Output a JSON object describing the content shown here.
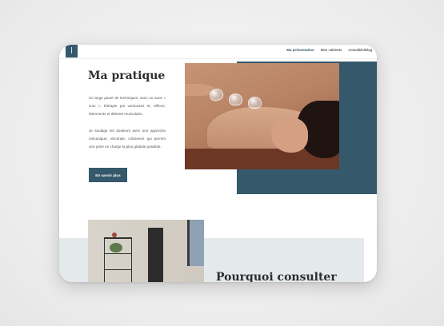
{
  "header": {
    "nav": [
      {
        "label": "Ma présentation",
        "active": true
      },
      {
        "label": "Mes cabinets",
        "active": false
      },
      {
        "label": "Actualités/Blog",
        "active": false
      }
    ]
  },
  "main": {
    "title": "Ma pratique",
    "paragraph1": "Un large panel de techniques, avec ou sans « crac », thérapie par ventouses et, réflexe, étirements et détente musculaire.",
    "paragraph2": "Je soulage les douleurs avec une approche mécanique, viscérale, crânienne qui permet une prise en charge la plus globale possible.",
    "cta_label": "En savoir plus"
  },
  "section2": {
    "title": "Pourquoi consulter"
  },
  "colors": {
    "accent": "#35586b",
    "band": "#e4e9ec"
  }
}
